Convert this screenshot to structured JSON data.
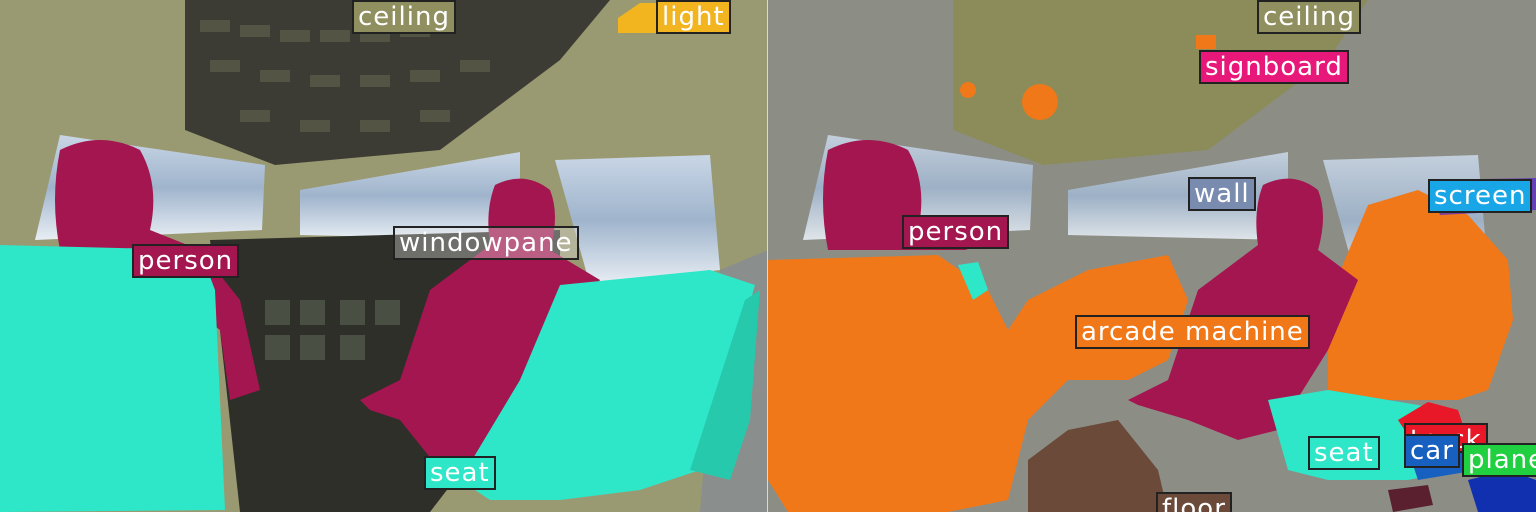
{
  "left_panel": {
    "labels": {
      "ceiling": "ceiling",
      "light": "light",
      "windowpane": "windowpane",
      "person": "person",
      "seat": "seat"
    }
  },
  "right_panel": {
    "labels": {
      "ceiling": "ceiling",
      "signboard": "signboard",
      "wall": "wall",
      "screen": "screen",
      "person": "person",
      "arcade_machine": "arcade machine",
      "seat": "seat",
      "truck": "truck",
      "car": "car",
      "plane": "plane",
      "floor": "floor"
    }
  },
  "colors": {
    "ceiling": "#8f8f60",
    "light": "#f2b520",
    "windowpane": "#e6e6e6",
    "person": "#a3164f",
    "seat": "#2ee6c8",
    "signboard": "#e8187a",
    "wall": "#7a8bb0",
    "screen": "#18a6e6",
    "arcade_machine": "#f07818",
    "truck": "#e81828",
    "car": "#1860c0",
    "plane": "#20d040",
    "floor": "#6b4a3a"
  }
}
